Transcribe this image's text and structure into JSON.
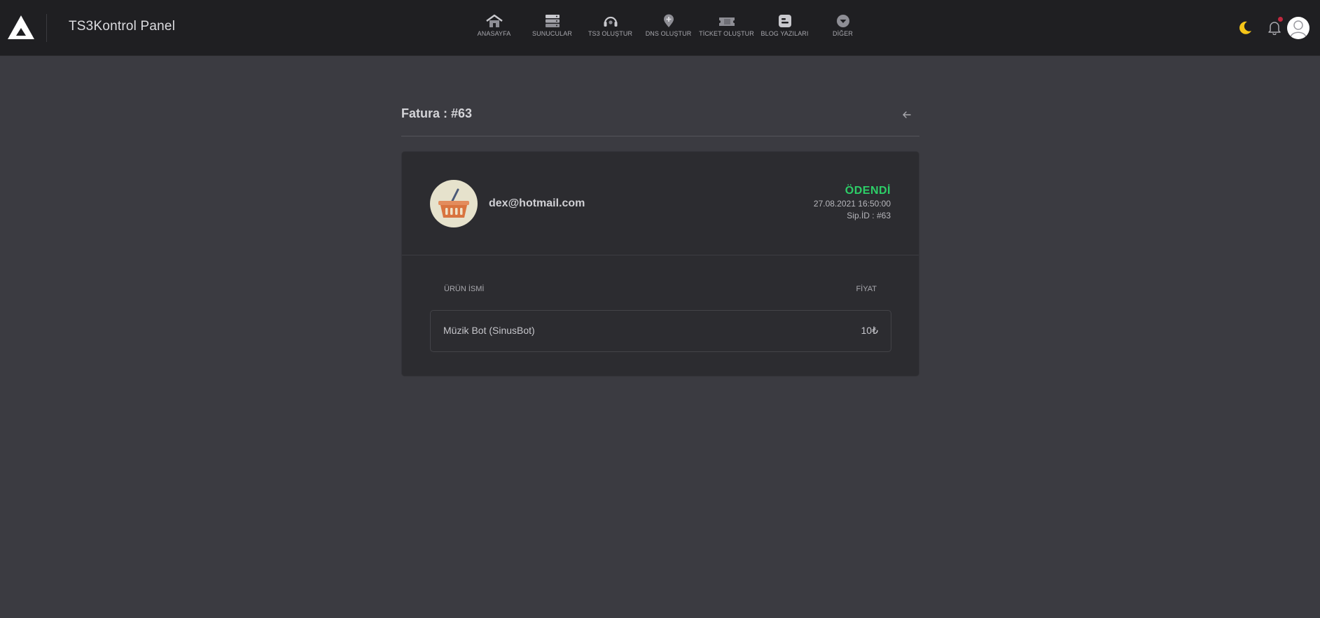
{
  "app": {
    "title": "TS3Kontrol Panel"
  },
  "nav": {
    "items": [
      {
        "label": "ANASAYFA",
        "icon": "home-icon"
      },
      {
        "label": "SUNUCULAR",
        "icon": "server-icon"
      },
      {
        "label": "TS3 OLUŞTUR",
        "icon": "headset-icon"
      },
      {
        "label": "DNS OLUŞTUR",
        "icon": "map-pin-icon"
      },
      {
        "label": "TİCKET OLUŞTUR",
        "icon": "ticket-icon"
      },
      {
        "label": "BLOG YAZILARI",
        "icon": "blog-icon"
      },
      {
        "label": "DİĞER",
        "icon": "chevron-down-circle-icon"
      }
    ]
  },
  "header_tools": {
    "theme_icon": "moon-icon",
    "notifications_icon": "bell-icon",
    "avatar_icon": "user-avatar-icon"
  },
  "page": {
    "title": "Fatura : #63",
    "back_icon": "arrow-left-icon"
  },
  "invoice": {
    "customer_email": "dex@hotmail.com",
    "status": "ÖDENDİ",
    "status_color": "#2dcf68",
    "date": "27.08.2021 16:50:00",
    "order_id": "Sip.İD : #63",
    "columns": {
      "name": "ÜRÜN İSMİ",
      "price": "FİYAT"
    },
    "items": [
      {
        "name": "Müzik Bot (SinusBot)",
        "price": "10₺"
      }
    ]
  },
  "colors": {
    "topbar_bg": "#1f1f22",
    "page_bg": "#3b3b41",
    "card_bg": "#2c2c30",
    "moon": "#f5c518",
    "notification_dot": "#c0283f"
  }
}
